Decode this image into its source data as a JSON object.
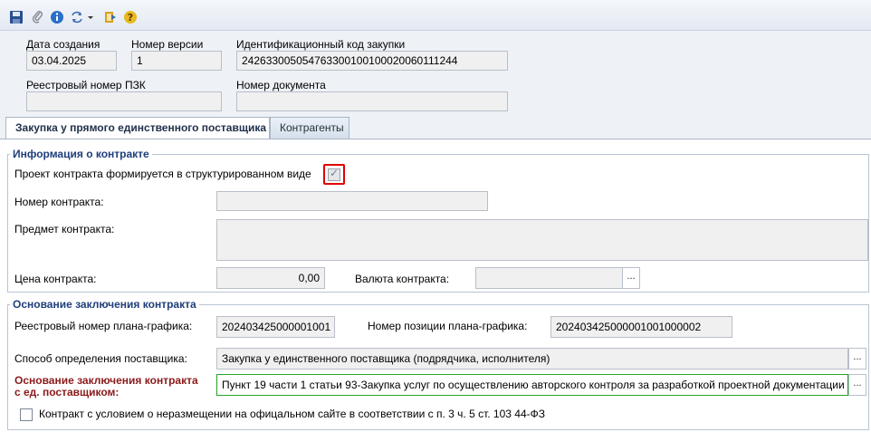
{
  "toolbar": {
    "buttons": [
      {
        "name": "save-icon",
        "color": "#2a4f8f"
      },
      {
        "name": "paperclip-icon",
        "color": "#8a8f99"
      },
      {
        "name": "info-icon",
        "color": "#2a6fc9"
      },
      {
        "name": "refresh-icon",
        "color": "#3a6db0"
      },
      {
        "name": "export-icon",
        "color": "#d8a020"
      },
      {
        "name": "help-icon",
        "color": "#e8b820"
      }
    ]
  },
  "header": {
    "date_created_label": "Дата создания",
    "date_created_value": "03.04.2025",
    "version_label": "Номер версии",
    "version_value": "1",
    "purchase_id_label": "Идентификационный код закупки",
    "purchase_id_value": "242633005054763300100100020060111244",
    "registry_number_label": "Реестровый номер ПЗК",
    "registry_number_value": "",
    "document_number_label": "Номер документа",
    "document_number_value": ""
  },
  "tabs": [
    {
      "label": "Закупка у прямого единственного поставщика",
      "active": true
    },
    {
      "label": "Контрагенты",
      "active": false
    }
  ],
  "contract_info": {
    "title": "Информация о контракте",
    "structured_label": "Проект контракта формируется в структурированном виде",
    "structured_checked": true,
    "number_label": "Номер контракта:",
    "number_value": "",
    "subject_label": "Предмет контракта:",
    "subject_value": "",
    "price_label": "Цена контракта:",
    "price_value": "0,00",
    "currency_label": "Валюта контракта:",
    "currency_value": "",
    "currency_button": "..."
  },
  "basis": {
    "title": "Основание заключения контракта",
    "plan_number_label": "Реестровый номер плана-графика:",
    "plan_number_value": "202403425000001001",
    "plan_position_label": "Номер позиции плана-графика:",
    "plan_position_value": "202403425000001001000002",
    "method_label": "Способ определения поставщика:",
    "method_value": "Закупка у единственного поставщика (подрядчика, исполнителя)",
    "method_button": "...",
    "basis_label_line1": "Основание заключения контракта",
    "basis_label_line2": "с ед. поставщиком:",
    "basis_value": "Пункт 19 части 1 статьи 93-Закупка услуг по осуществлению авторского контроля за разработкой проектной документации",
    "basis_button": "...",
    "nonpublish_label": "Контракт с условием о неразмещении на офицальном сайте в соответствии с п. 3 ч. 5 ст. 103 44-ФЗ",
    "nonpublish_checked": false
  }
}
